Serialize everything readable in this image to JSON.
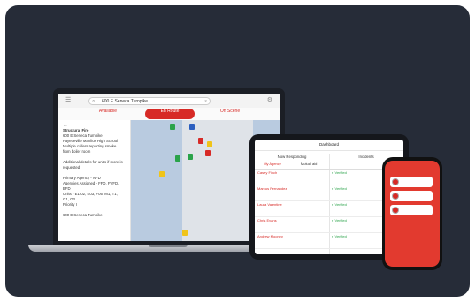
{
  "laptop": {
    "search_value": "600 E Seneca Turnpike",
    "statuses": [
      {
        "line1": "",
        "line2": "Available"
      },
      {
        "line1": "",
        "line2": "En Route"
      },
      {
        "line1": "",
        "line2": "On Scene"
      }
    ],
    "sidepanel": {
      "lines": [
        "Structural Fire",
        "600 E Seneca Turnpike",
        "Fayetteville Manlius High School",
        "Multiple callers reporting smoke",
        "from boiler room",
        "",
        "Additional details for units if more is",
        "requested",
        "",
        "Primary Agency - NFD",
        "Agencies Assigned - FFD, FVFD, BFD",
        "Units - E1-02, E03, F05, M1, T1,",
        "G1, G3",
        "Priority I",
        "",
        "600 E Seneca Turnpike"
      ]
    }
  },
  "tablet": {
    "title": "Dashboard",
    "left_header": "Now Responding",
    "left_tabs": [
      "My Agency",
      "Mutual aid"
    ],
    "responders": [
      {
        "name": "Casey Finch",
        "line2": "",
        "line3": "",
        "status": "",
        "eta": ""
      },
      {
        "name": "Marcus Fernandez",
        "line2": "",
        "line3": "",
        "status": "",
        "eta": ""
      },
      {
        "name": "Laura Valentine",
        "line2": "",
        "line3": "",
        "status": "",
        "eta": ""
      },
      {
        "name": "Chris Evans",
        "line2": "",
        "line3": "",
        "status": "",
        "eta": ""
      },
      {
        "name": "Andrew Mooney",
        "line2": "",
        "line3": "",
        "status": "",
        "eta": ""
      }
    ],
    "right_header": "Incidents",
    "right_tabs": [
      "",
      ""
    ],
    "incidents": [
      {
        "label": "Verified",
        "line1": "",
        "line2": ""
      },
      {
        "label": "Verified",
        "line1": "",
        "line2": ""
      },
      {
        "label": "Verified",
        "line1": "",
        "line2": ""
      },
      {
        "label": "Verified",
        "line1": "",
        "line2": ""
      },
      {
        "label": "Verified",
        "line1": "",
        "line2": ""
      }
    ]
  },
  "phone": {
    "header": "",
    "items": [
      {
        "title": "",
        "subtitle": ""
      },
      {
        "title": "",
        "subtitle": ""
      },
      {
        "title": "",
        "subtitle": ""
      }
    ]
  },
  "colors": {
    "background": "#262c38",
    "accent_red": "#d72a26",
    "verified_green": "#2aa34a",
    "map_water": "#b9cbe0"
  }
}
